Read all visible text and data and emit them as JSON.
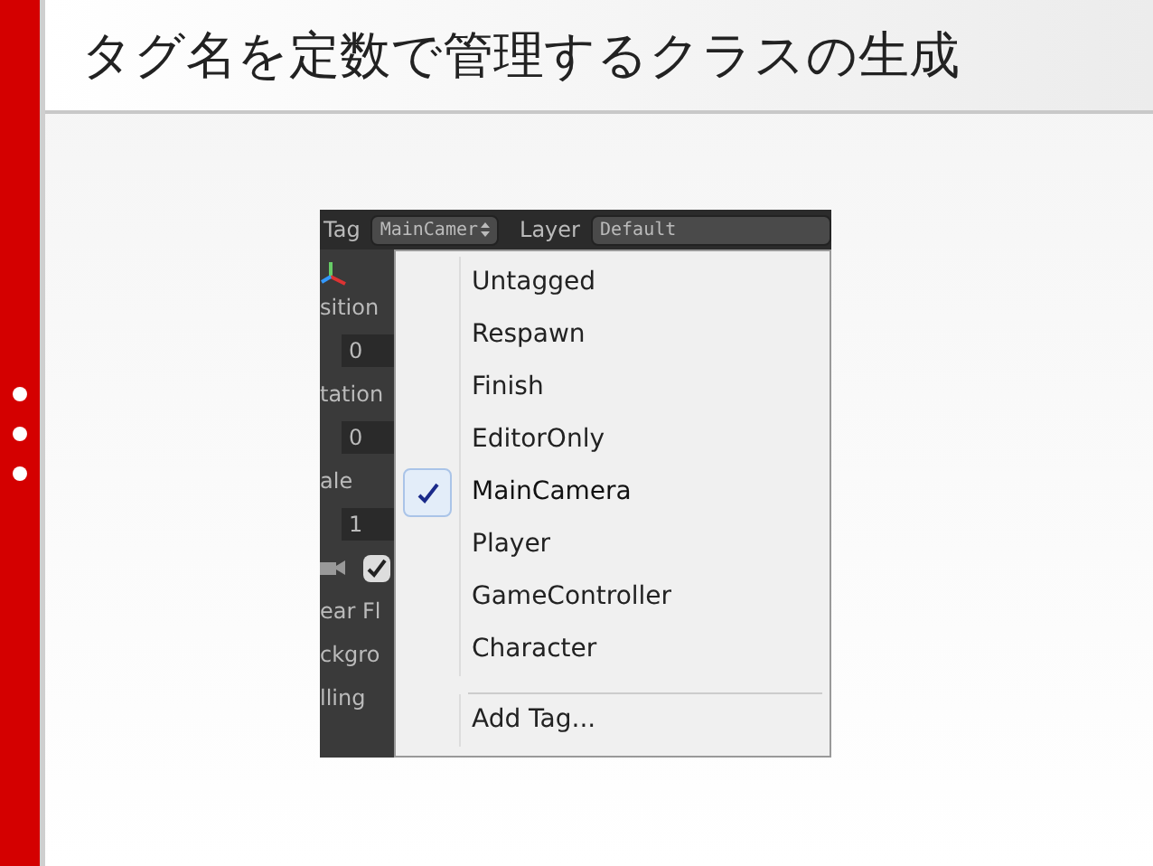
{
  "slide": {
    "title": "タグ名を定数で管理するクラスの生成"
  },
  "inspector": {
    "tag_label": "Tag",
    "tag_value": "MainCamer",
    "layer_label": "Layer",
    "layer_value": "Default",
    "fields": [
      {
        "kind": "label",
        "text": "sition"
      },
      {
        "kind": "value",
        "text": "0"
      },
      {
        "kind": "label",
        "text": "tation"
      },
      {
        "kind": "value",
        "text": "0"
      },
      {
        "kind": "label",
        "text": "ale"
      },
      {
        "kind": "value",
        "text": "1"
      },
      {
        "kind": "camera",
        "checked": true
      },
      {
        "kind": "label",
        "text": "ear Fl"
      },
      {
        "kind": "label",
        "text": "ckgro"
      },
      {
        "kind": "label",
        "text": "lling"
      }
    ]
  },
  "menu": {
    "items": [
      {
        "label": "Untagged",
        "selected": false
      },
      {
        "label": "Respawn",
        "selected": false
      },
      {
        "label": "Finish",
        "selected": false
      },
      {
        "label": "EditorOnly",
        "selected": false
      },
      {
        "label": "MainCamera",
        "selected": true
      },
      {
        "label": "Player",
        "selected": false
      },
      {
        "label": "GameController",
        "selected": false
      },
      {
        "label": "Character",
        "selected": false
      }
    ],
    "footer": "Add Tag..."
  }
}
